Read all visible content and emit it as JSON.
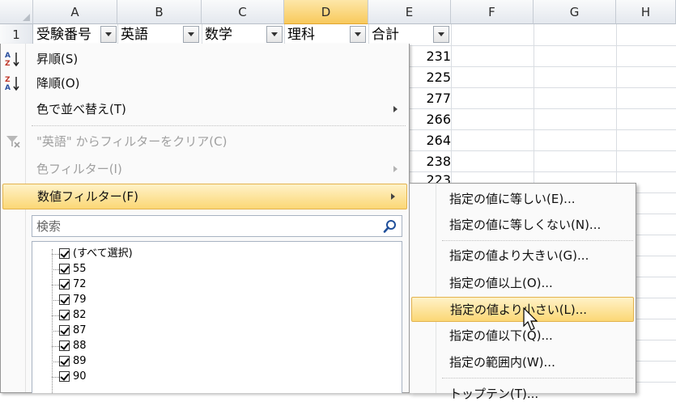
{
  "columns": [
    "A",
    "B",
    "C",
    "D",
    "E",
    "F",
    "G",
    "H"
  ],
  "row_numbers": [
    "1"
  ],
  "headers": {
    "a": "受験番号",
    "b": "英語",
    "c": "数学",
    "d": "理科",
    "e": "合計"
  },
  "totals": [
    "231",
    "225",
    "277",
    "266",
    "264",
    "238",
    "223"
  ],
  "menu": {
    "sort_asc": "昇順(S)",
    "sort_desc": "降順(O)",
    "sort_color": "色で並べ替え(T)",
    "clear_filter": "\"英語\" からフィルターをクリア(C)",
    "color_filter": "色フィルター(I)",
    "number_filter": "数値フィルター(F)"
  },
  "search": {
    "placeholder": "検索"
  },
  "list_items": [
    "(すべて選択)",
    "55",
    "72",
    "79",
    "82",
    "87",
    "88",
    "89",
    "90"
  ],
  "submenu": {
    "equals": "指定の値に等しい(E)...",
    "not_equals": "指定の値に等しくない(N)...",
    "greater": "指定の値より大きい(G)...",
    "greater_equal": "指定の値以上(O)...",
    "less": "指定の値より小さい(L)...",
    "less_equal": "指定の値以下(Q)...",
    "between": "指定の範囲内(W)...",
    "top10": "トップテン(T)..."
  },
  "colors": {
    "highlight": "#fbd775",
    "selected_column": "#f8c95c",
    "icon_blue": "#2a4f9e"
  },
  "icons": [
    "sort-asc-icon",
    "sort-desc-icon",
    "clear-filter-icon",
    "search-icon",
    "checkbox-checked-icon",
    "submenu-arrow-icon",
    "mouse-cursor-icon",
    "dropdown-arrow-icon"
  ]
}
